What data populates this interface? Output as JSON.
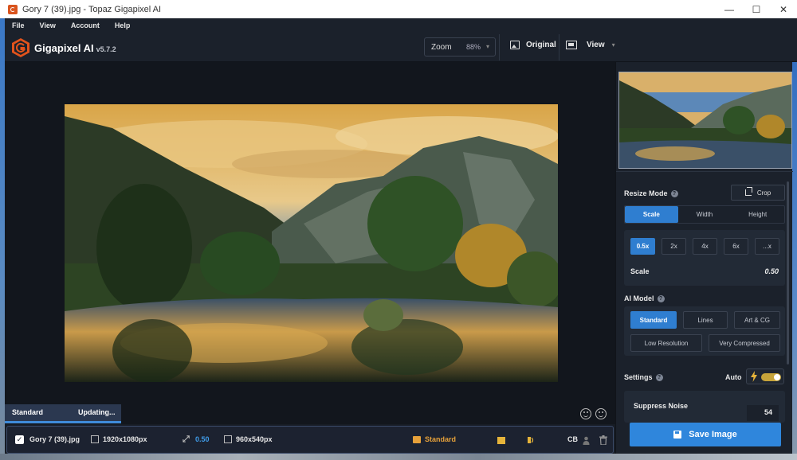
{
  "window": {
    "title": "Gory 7 (39).jpg - Topaz Gigapixel AI",
    "minimize": "—",
    "maximize": "☐",
    "close": "✕"
  },
  "menu": [
    "File",
    "View",
    "Account",
    "Help"
  ],
  "header": {
    "brand": "Gigapixel AI",
    "version": "v5.7.2",
    "zoom_label": "Zoom",
    "zoom_value": "88%",
    "original_label": "Original",
    "view_label": "View"
  },
  "status": {
    "model": "Standard",
    "state": "Updating..."
  },
  "filebar": {
    "filename": "Gory 7 (39).jpg",
    "input_size": "1920x1080px",
    "scale": "0.50",
    "output_size": "960x540px",
    "model": "Standard",
    "cb": "CB"
  },
  "panel": {
    "resize_mode_label": "Resize Mode",
    "crop_label": "Crop",
    "resize_tabs": [
      "Scale",
      "Width",
      "Height"
    ],
    "scale_options": [
      "0.5x",
      "2x",
      "4x",
      "6x",
      "...x"
    ],
    "scale_label": "Scale",
    "scale_value": "0.50",
    "ai_model_label": "AI Model",
    "models": [
      "Standard",
      "Lines",
      "Art & CG",
      "Low Resolution",
      "Very Compressed"
    ],
    "settings_label": "Settings",
    "auto_label": "Auto",
    "suppress_noise_label": "Suppress Noise",
    "suppress_noise_value": "54",
    "save_label": "Save Image"
  },
  "colors": {
    "accent_blue": "#2f7ed0",
    "accent_orange": "#e6a13a",
    "background": "#171c25"
  }
}
